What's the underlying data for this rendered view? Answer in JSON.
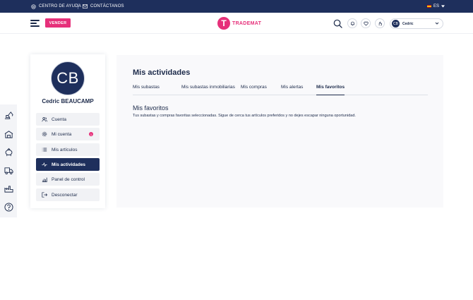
{
  "topbar": {
    "help": "CENTRO DE AYUDA",
    "contact": "CONTÁCTANOS",
    "language": "ES"
  },
  "header": {
    "sell_button": "VENDER",
    "brand": "TRADEMAT",
    "brand_mark": "T",
    "user_initials": "CB",
    "user_name": "Cedric"
  },
  "profile": {
    "initials": "CB",
    "name": "Cedric BEAUCAMP",
    "menu": [
      {
        "label": "Cuenta",
        "icon": "users-icon"
      },
      {
        "label": "Mi cuenta",
        "icon": "gear-icon",
        "badge": "1"
      },
      {
        "label": "Mis artículos",
        "icon": "list-icon"
      },
      {
        "label": "Mis actividades",
        "icon": "activity-icon",
        "active": true
      },
      {
        "label": "Panel de control",
        "icon": "bar-chart-icon"
      },
      {
        "label": "Desconectar",
        "icon": "logout-icon"
      }
    ]
  },
  "main": {
    "title": "Mis actividades",
    "tabs": [
      "Mis subastas",
      "Mis subastas inmobiliarias",
      "Mis compras",
      "Mis alertas",
      "Mis favoritos"
    ],
    "active_tab": "Mis favoritos",
    "section_title": "Mis favoritos",
    "section_description": "Tus subastas y compras favoritas seleccionadas. Sigue de cerca tus artículos preferidos y no dejes escapar ninguna oportunidad."
  },
  "rail_icons": [
    "excavator-icon",
    "building-icon",
    "piggy-bank-icon",
    "truck-icon",
    "factory-icon",
    "help-circle-icon"
  ],
  "colors": {
    "navy": "#1e2f5c",
    "accent": "#e6307a"
  }
}
